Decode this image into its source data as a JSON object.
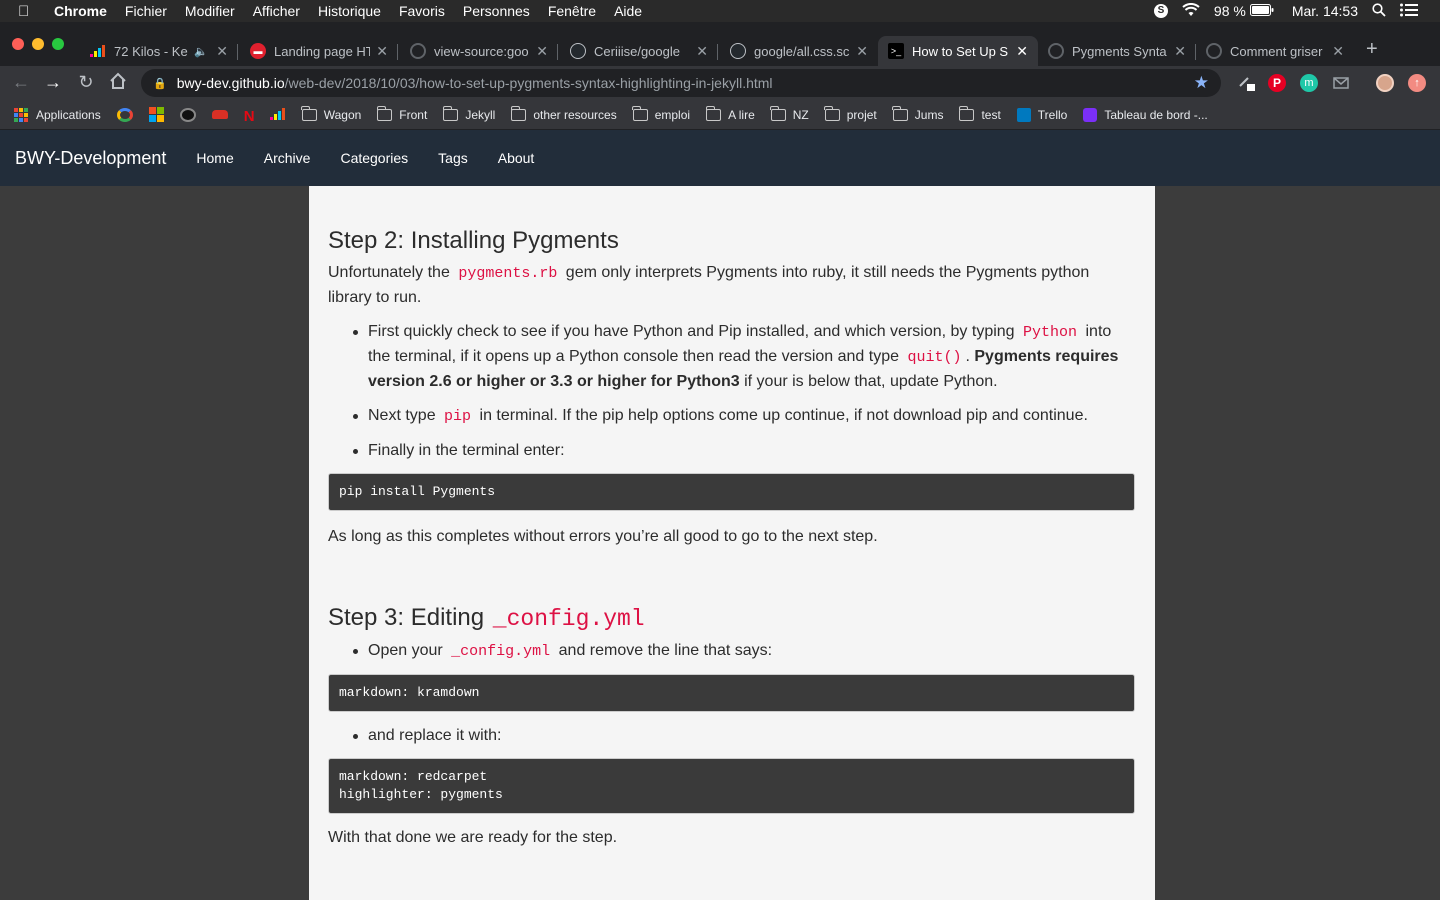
{
  "menubar": {
    "app": "Chrome",
    "items": [
      "Fichier",
      "Modifier",
      "Afficher",
      "Historique",
      "Favoris",
      "Personnes",
      "Fenêtre",
      "Aide"
    ],
    "battery": "98 %",
    "clock": "Mar. 14:53"
  },
  "tabs": [
    {
      "title": "72 Kilos - Ke",
      "favicon": "deezer-icon",
      "color": "#e94f1b"
    },
    {
      "title": "Landing page HT",
      "favicon": "site-icon",
      "color": "#e0202e"
    },
    {
      "title": "view-source:goo",
      "favicon": "globe-icon",
      "color": "#5f6368"
    },
    {
      "title": "Ceriiise/google",
      "favicon": "github-icon",
      "color": "#24292e"
    },
    {
      "title": "google/all.css.sc",
      "favicon": "github-icon",
      "color": "#24292e"
    },
    {
      "title": "How to Set Up S",
      "favicon": "terminal-icon",
      "color": "#000000"
    },
    {
      "title": "Pygments Synta",
      "favicon": "globe-icon",
      "color": "#5f6368"
    },
    {
      "title": "Comment griser",
      "favicon": "globe-icon",
      "color": "#5f6368"
    }
  ],
  "omnibox": {
    "host": "bwy-dev.github.io",
    "path": "/web-dev/2018/10/03/how-to-set-up-pygments-syntax-highlighting-in-jekyll.html"
  },
  "bookmarks": {
    "apps": "Applications",
    "folders": [
      "Wagon",
      "Front",
      "Jekyll",
      "other resources",
      "emploi",
      "A lire",
      "NZ",
      "projet",
      "Jums",
      "test"
    ],
    "trello": "Trello",
    "dashboard": "Tableau de bord -..."
  },
  "site": {
    "brand": "BWY-Development",
    "nav": [
      "Home",
      "Archive",
      "Categories",
      "Tags",
      "About"
    ]
  },
  "article": {
    "step2": {
      "heading": "Step 2: Installing Pygments",
      "intro_a": "Unfortunately the",
      "intro_code": "pygments.rb",
      "intro_b": "gem only interprets Pygments into ruby, it still needs the Pygments python library to run.",
      "li1_a": "First quickly check to see if you have Python and Pip installed, and which version, by typing",
      "li1_code1": "Python",
      "li1_b": "into the terminal, if it opens up a Python console then read the version and type",
      "li1_code2": "quit()",
      "li1_c": ".",
      "li1_bold": "Pygments requires version 2.6 or higher or 3.3 or higher for Python3",
      "li1_d": "if your is below that, update Python.",
      "li2_a": "Next type",
      "li2_code": "pip",
      "li2_b": "in terminal. If the pip help options come up continue, if not download pip and continue.",
      "li3": "Finally in the terminal enter:",
      "code_block": "pip install Pygments",
      "outro": "As long as this completes without errors you’re all good to go to the next step."
    },
    "step3": {
      "heading": "Step 3: Editing",
      "heading_code": "_config.yml",
      "li1_a": "Open your",
      "li1_code": "_config.yml",
      "li1_b": "and remove the line that says:",
      "code_block1": "markdown: kramdown",
      "li2": "and replace it with:",
      "code_block2": "markdown: redcarpet\nhighlighter: pygments",
      "outro": "With that done we are ready for the step."
    }
  }
}
